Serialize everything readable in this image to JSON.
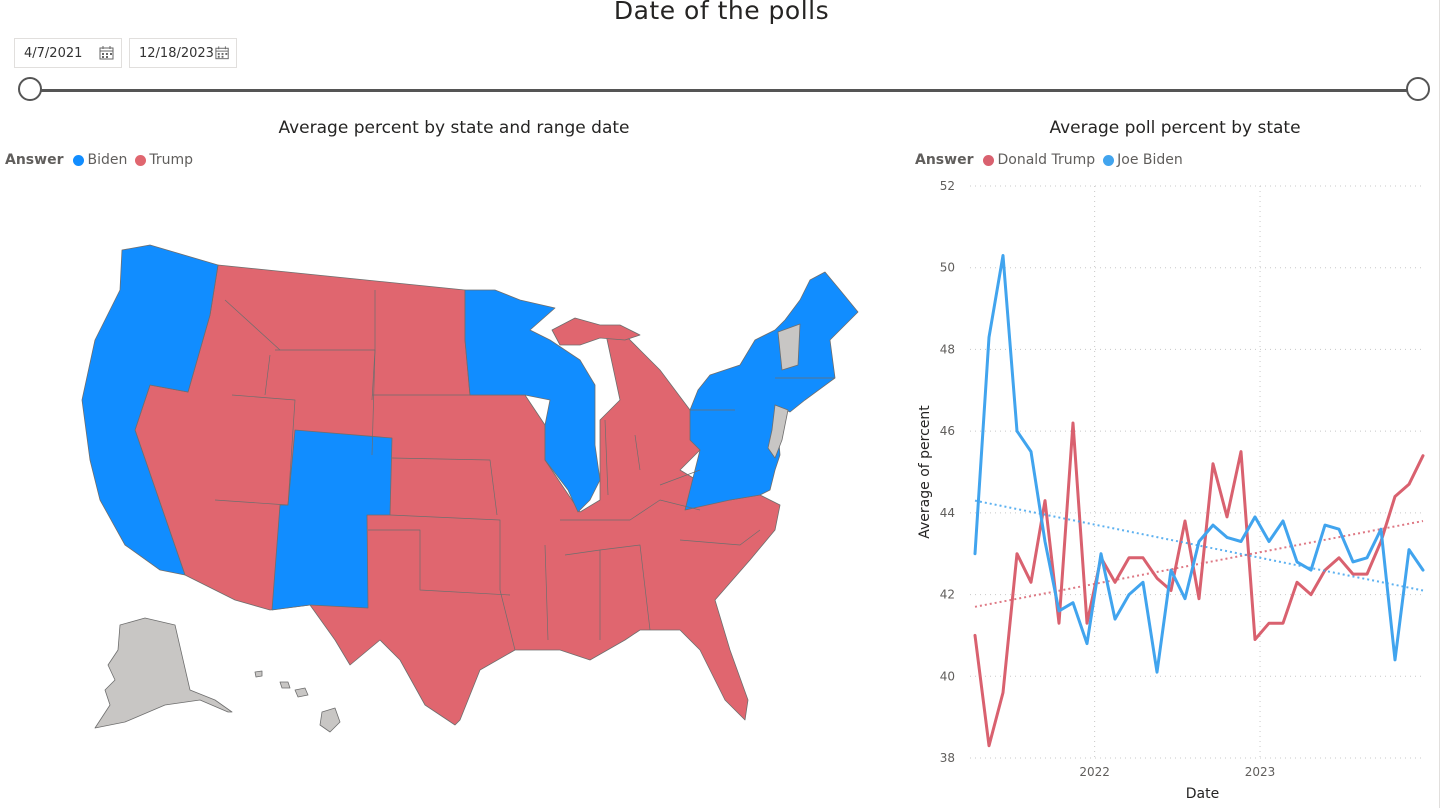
{
  "header": {
    "title": "Date of the polls"
  },
  "date_filter": {
    "start": "4/7/2021",
    "end": "12/18/2023",
    "slider_start": 0,
    "slider_end": 1
  },
  "map_visual": {
    "title": "Average percent by state and range date",
    "legend_title": "Answer",
    "legend": [
      {
        "label": "Biden",
        "color": "#118dff"
      },
      {
        "label": "Trump",
        "color": "#e0666f"
      }
    ],
    "no_data_color": "#c8c6c4"
  },
  "line_visual": {
    "title": "Average poll percent by state",
    "legend_title": "Answer",
    "legend": [
      {
        "label": "Donald Trump",
        "color": "#d9616f"
      },
      {
        "label": "Joe Biden",
        "color": "#41a4ee"
      }
    ]
  },
  "chart_data": {
    "type": "line",
    "title": "Average poll percent by state",
    "xlabel": "Date",
    "ylabel": "Average of percent",
    "ylim": [
      38,
      52
    ],
    "yticks": [
      38,
      40,
      42,
      44,
      46,
      48,
      50,
      52
    ],
    "xlim": [
      "2021-04-01",
      "2023-12-31"
    ],
    "xticks": [
      {
        "label": "2022",
        "date": "2022-01-01"
      },
      {
        "label": "2023",
        "date": "2023-01-01"
      }
    ],
    "grid": true,
    "legend_position": "top-left",
    "x": [
      "2021-04",
      "2021-05",
      "2021-06",
      "2021-07",
      "2021-08",
      "2021-09",
      "2021-10",
      "2021-11",
      "2021-12",
      "2022-01",
      "2022-02",
      "2022-03",
      "2022-04",
      "2022-05",
      "2022-06",
      "2022-07",
      "2022-08",
      "2022-09",
      "2022-10",
      "2022-11",
      "2022-12",
      "2023-01",
      "2023-02",
      "2023-03",
      "2023-04",
      "2023-05",
      "2023-06",
      "2023-07",
      "2023-08",
      "2023-09",
      "2023-10",
      "2023-11",
      "2023-12"
    ],
    "series": [
      {
        "name": "Donald Trump",
        "color": "#d9616f",
        "values": [
          41.0,
          38.3,
          39.6,
          43.0,
          42.3,
          44.3,
          41.3,
          46.2,
          41.3,
          42.9,
          42.3,
          42.9,
          42.9,
          42.4,
          42.1,
          43.8,
          41.9,
          45.2,
          43.9,
          45.5,
          40.9,
          41.3,
          41.3,
          42.3,
          42.0,
          42.6,
          42.9,
          42.5,
          42.5,
          43.3,
          44.4,
          44.7,
          45.4
        ],
        "trend": [
          41.7,
          43.8
        ]
      },
      {
        "name": "Joe Biden",
        "color": "#41a4ee",
        "values": [
          43.0,
          48.3,
          50.3,
          46.0,
          45.5,
          43.3,
          41.6,
          41.8,
          40.8,
          43.0,
          41.4,
          42.0,
          42.3,
          40.1,
          42.6,
          41.9,
          43.3,
          43.7,
          43.4,
          43.3,
          43.9,
          43.3,
          43.8,
          42.8,
          42.6,
          43.7,
          43.6,
          42.8,
          42.9,
          43.6,
          40.4,
          43.1,
          42.6
        ],
        "trend": [
          44.3,
          42.1
        ]
      }
    ]
  }
}
